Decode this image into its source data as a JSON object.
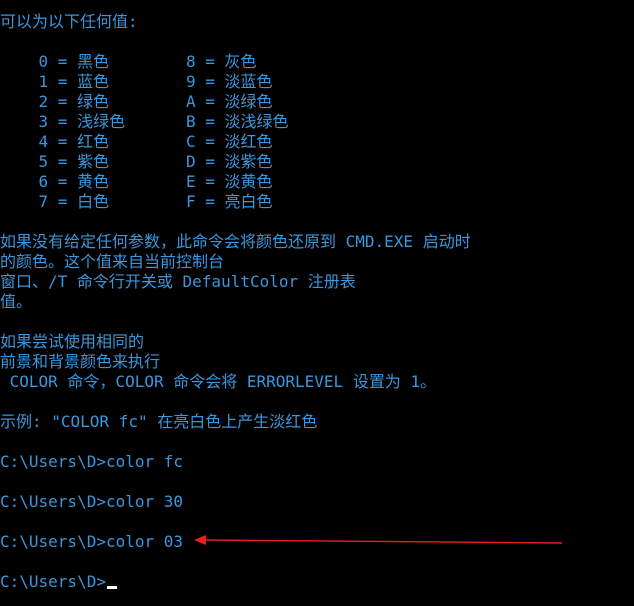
{
  "console": {
    "text_color": "#3a96dd",
    "background": "#000000",
    "cursor_color": "#ffffff",
    "lines": [
      "可以为以下任何值:",
      "",
      [
        "    0 = 黑色",
        "8 = 灰色"
      ],
      [
        "    1 = 蓝色",
        "9 = 淡蓝色"
      ],
      [
        "    2 = 绿色",
        "A = 淡绿色"
      ],
      [
        "    3 = 浅绿色",
        "B = 淡浅绿色"
      ],
      [
        "    4 = 红色",
        "C = 淡红色"
      ],
      [
        "    5 = 紫色",
        "D = 淡紫色"
      ],
      [
        "    6 = 黄色",
        "E = 淡黄色"
      ],
      [
        "    7 = 白色",
        "F = 亮白色"
      ],
      "",
      "如果没有给定任何参数，此命令会将颜色还原到 CMD.EXE 启动时",
      "的颜色。这个值来自当前控制台",
      "窗口、/T 命令行开关或 DefaultColor 注册表",
      "值。",
      "",
      "如果尝试使用相同的",
      "前景和背景颜色来执行",
      " COLOR 命令，COLOR 命令会将 ERRORLEVEL 设置为 1。",
      "",
      "示例: \"COLOR fc\" 在亮白色上产生淡红色",
      "",
      "C:\\Users\\D>color fc",
      "",
      "C:\\Users\\D>color 30",
      "",
      "C:\\Users\\D>color 03",
      "",
      "C:\\Users\\D>"
    ]
  },
  "annotation": {
    "arrow_color": "#e8201a",
    "target_line": "C:\\Users\\D>color 03"
  }
}
